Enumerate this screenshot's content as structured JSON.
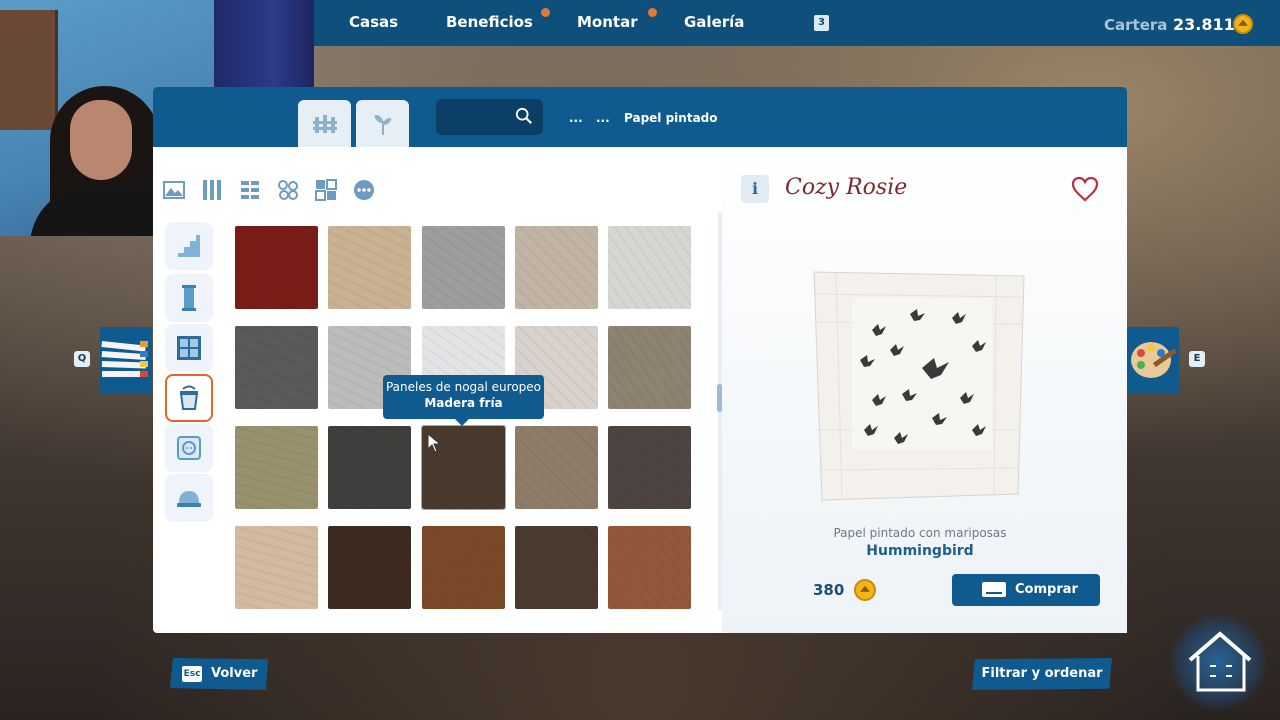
{
  "topbar": {
    "nav": [
      "Casas",
      "Beneficios",
      "Montar",
      "Galería"
    ],
    "notification_count": "3",
    "wallet_label": "Cartera",
    "wallet_value": "23.811"
  },
  "panel": {
    "breadcrumb": [
      "...",
      "...",
      "Papel pintado"
    ],
    "tabs": [
      "fence-icon",
      "plant-icon"
    ]
  },
  "tooltip": {
    "line1": "Paneles de nogal europeo",
    "line2": "Madera fría"
  },
  "product": {
    "brand": "Cozy Rosie",
    "subtitle": "Papel pintado con mariposas",
    "name": "Hummingbird",
    "price": "380",
    "buy_label": "Comprar"
  },
  "keys": {
    "left": "Q",
    "right": "E",
    "esc": "Esc"
  },
  "footer": {
    "back_label": "Volver",
    "filter_label": "Filtrar y ordenar"
  },
  "swatches": [
    [
      "#7a1c17",
      "#c9b193",
      "#9d9d9b",
      "#c2b4a5",
      "#d8d6d2"
    ],
    [
      "#5b5a58",
      "#bdbcba",
      "#e2e4e6",
      "#d9d1cb",
      "#8e8370"
    ],
    [
      "#98916d",
      "#3e3e3c",
      "#4a3a2e",
      "#8e7c68",
      "#4d4440"
    ],
    [
      "#d2bba0",
      "#3d2a20",
      "#7a4a28",
      "#4a3a30",
      "#93583a"
    ]
  ],
  "colors": {
    "accent_blue": "#0f5a8e",
    "active_orange": "#e2672a",
    "coin_gold": "#f2b519"
  }
}
